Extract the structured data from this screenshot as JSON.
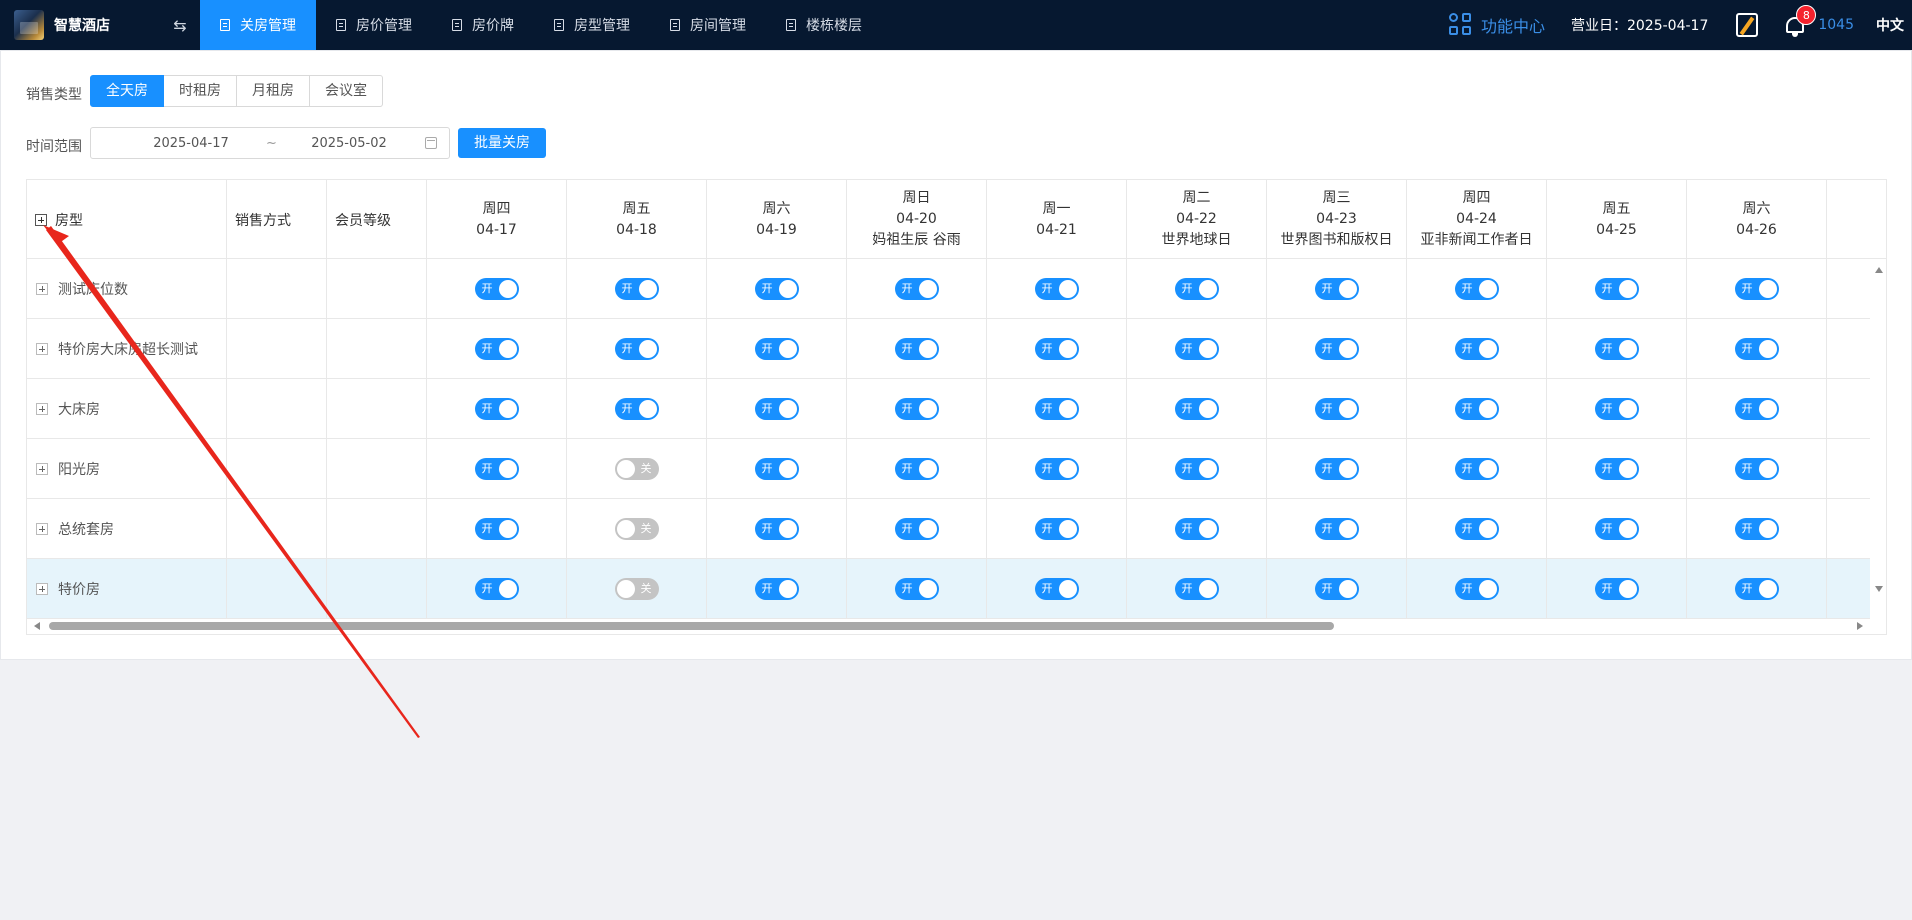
{
  "brand": {
    "name": "智慧酒店"
  },
  "nav": {
    "swap_icon": "⇆",
    "items": [
      {
        "label": "关房管理",
        "active": true
      },
      {
        "label": "房价管理",
        "active": false
      },
      {
        "label": "房价牌",
        "active": false
      },
      {
        "label": "房型管理",
        "active": false
      },
      {
        "label": "房间管理",
        "active": false
      },
      {
        "label": "楼栋楼层",
        "active": false
      }
    ]
  },
  "header_right": {
    "function_center": "功能中心",
    "business_date": "营业日：2025-04-17",
    "notification_count": "8",
    "user_id": "1045",
    "language": "中文"
  },
  "filters": {
    "sales_type_label": "销售类型",
    "sales_types": [
      {
        "label": "全天房",
        "active": true
      },
      {
        "label": "时租房",
        "active": false
      },
      {
        "label": "月租房",
        "active": false
      },
      {
        "label": "会议室",
        "active": false
      }
    ],
    "time_range_label": "时间范围",
    "date_start": "2025-04-17",
    "date_sep": "~",
    "date_end": "2025-05-02",
    "batch_close_button": "批量关房"
  },
  "table": {
    "col_room_type": "房型",
    "col_sale_method": "销售方式",
    "col_member_level": "会员等级",
    "days": [
      {
        "weekday": "周四",
        "date": "04-17",
        "note": ""
      },
      {
        "weekday": "周五",
        "date": "04-18",
        "note": ""
      },
      {
        "weekday": "周六",
        "date": "04-19",
        "note": ""
      },
      {
        "weekday": "周日",
        "date": "04-20",
        "note": "妈祖生辰 谷雨"
      },
      {
        "weekday": "周一",
        "date": "04-21",
        "note": ""
      },
      {
        "weekday": "周二",
        "date": "04-22",
        "note": "世界地球日"
      },
      {
        "weekday": "周三",
        "date": "04-23",
        "note": "世界图书和版权日"
      },
      {
        "weekday": "周四",
        "date": "04-24",
        "note": "亚非新闻工作者日"
      },
      {
        "weekday": "周五",
        "date": "04-25",
        "note": ""
      },
      {
        "weekday": "周六",
        "date": "04-26",
        "note": ""
      }
    ],
    "switch_on_text": "开",
    "switch_off_text": "关",
    "rows": [
      {
        "name": "测试床位数",
        "highlight": false,
        "states": [
          1,
          1,
          1,
          1,
          1,
          1,
          1,
          1,
          1,
          1
        ]
      },
      {
        "name": "特价房大床房超长测试",
        "highlight": false,
        "states": [
          1,
          1,
          1,
          1,
          1,
          1,
          1,
          1,
          1,
          1
        ]
      },
      {
        "name": "大床房",
        "highlight": false,
        "states": [
          1,
          1,
          1,
          1,
          1,
          1,
          1,
          1,
          1,
          1
        ]
      },
      {
        "name": "阳光房",
        "highlight": false,
        "states": [
          1,
          0,
          1,
          1,
          1,
          1,
          1,
          1,
          1,
          1
        ]
      },
      {
        "name": "总统套房",
        "highlight": false,
        "states": [
          1,
          0,
          1,
          1,
          1,
          1,
          1,
          1,
          1,
          1
        ]
      },
      {
        "name": "特价房",
        "highlight": true,
        "states": [
          1,
          0,
          1,
          1,
          1,
          1,
          1,
          1,
          1,
          1
        ]
      }
    ]
  },
  "colors": {
    "topbar": "#061830",
    "accent": "#1890ff",
    "switch_off": "#c4c4c4",
    "row_highlight": "#e6f4fb",
    "annotation": "#e8261c"
  }
}
